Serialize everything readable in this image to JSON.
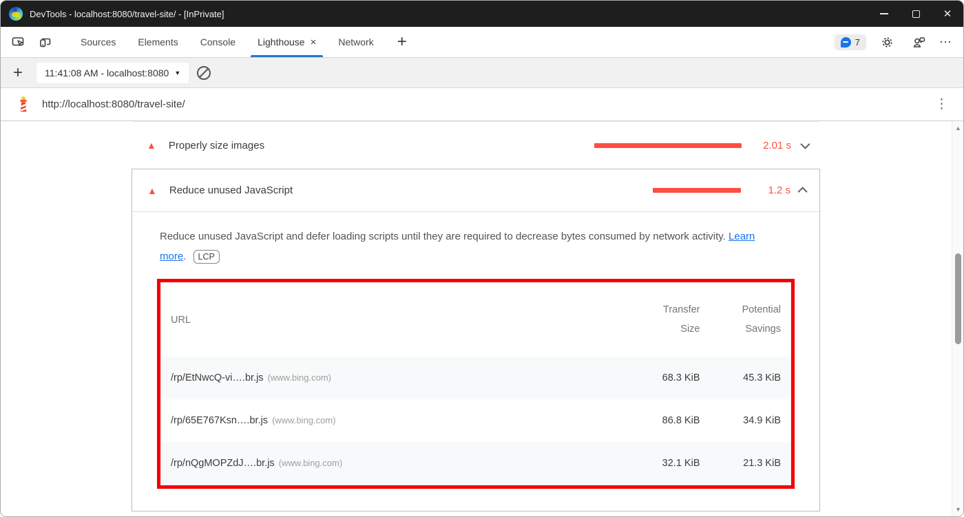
{
  "window": {
    "title": "DevTools - localhost:8080/travel-site/ - [InPrivate]"
  },
  "icons": {
    "fail_triangle": "▲",
    "caret_down": "▼",
    "kebab_vertical": "⋮",
    "dots_horizontal": "⋯",
    "plus": "+",
    "close": "✕",
    "tab_close": "×",
    "scroll_up": "▲",
    "scroll_down": "▼"
  },
  "devtools": {
    "tabs": [
      {
        "label": "Sources"
      },
      {
        "label": "Elements"
      },
      {
        "label": "Console"
      },
      {
        "label": "Lighthouse"
      },
      {
        "label": "Network"
      }
    ],
    "issues_count": "7"
  },
  "lighthouse_toolbar": {
    "report_selector": "11:41:08 AM - localhost:8080"
  },
  "url_bar": {
    "url": "http://localhost:8080/travel-site/"
  },
  "report": {
    "audits": [
      {
        "title": "Properly size images",
        "value": "2.01 s",
        "expanded": false,
        "bar_css": "width:214px"
      },
      {
        "title": "Reduce unused JavaScript",
        "value": "1.2 s",
        "expanded": true,
        "bar_css": "width:128px",
        "description": "Reduce unused JavaScript and defer loading scripts until they are required to decrease bytes consumed by network activity.",
        "learn_more_label": "Learn more",
        "after_link_punctuation": ".",
        "metric_badge": "LCP",
        "table": {
          "headers": {
            "url": "URL",
            "transfer_size": "Transfer Size",
            "potential_savings": "Potential Savings"
          },
          "rows": [
            {
              "url": "/rp/EtNwcQ-vi….br.js",
              "host": "(www.bing.com)",
              "transfer_size": "68.3 KiB",
              "potential_savings": "45.3 KiB"
            },
            {
              "url": "/rp/65E767Ksn….br.js",
              "host": "(www.bing.com)",
              "transfer_size": "86.8 KiB",
              "potential_savings": "34.9 KiB"
            },
            {
              "url": "/rp/nQgMOPZdJ….br.js",
              "host": "(www.bing.com)",
              "transfer_size": "32.1 KiB",
              "potential_savings": "21.3 KiB"
            }
          ]
        }
      }
    ]
  },
  "colors": {
    "fail_red": "#ff4e42",
    "highlight_red": "#f50000",
    "accent_blue": "#1f7ad6",
    "link_blue": "#1a73e8",
    "titlebar_bg": "#1e1e1e"
  }
}
